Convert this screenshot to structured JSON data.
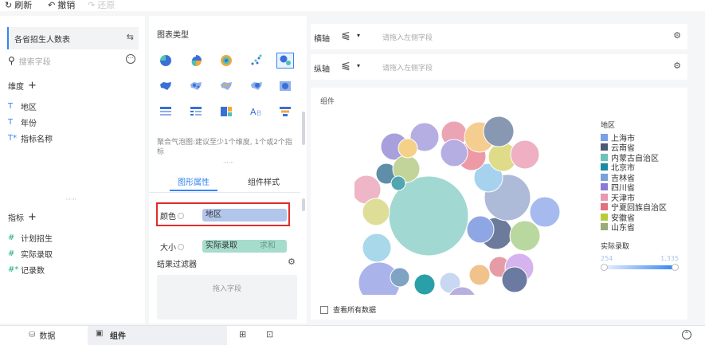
{
  "toolbar": {
    "refresh": "刷新",
    "undo": "撤销",
    "redo": "还原"
  },
  "left": {
    "dataset_name": "各省招生人数表",
    "search_placeholder": "搜索字段",
    "dimension_header": "维度",
    "dimensions": [
      {
        "type": "T",
        "label": "地区"
      },
      {
        "type": "T",
        "label": "年份"
      },
      {
        "type": "T*",
        "label": "指标名称"
      }
    ],
    "measure_header": "指标",
    "measures": [
      {
        "type": "#",
        "label": "计划招生"
      },
      {
        "type": "#",
        "label": "实际录取"
      },
      {
        "type": "#*",
        "label": "记录数"
      }
    ]
  },
  "mid": {
    "chart_type_title": "图表类型",
    "chart_hint": "聚合气泡图:建议至少1个维度, 1个或2个指标",
    "tab_shape": "图形属性",
    "tab_style": "组件样式",
    "color_label": "颜色",
    "color_value": "地区",
    "size_label": "大小",
    "size_value": "实际录取",
    "size_agg": "求和",
    "filter_title": "结果过滤器",
    "filter_drop": "拖入字段"
  },
  "right": {
    "x_axis_label": "横轴",
    "x_axis_placeholder": "请拖入左侧字段",
    "y_axis_label": "纵轴",
    "y_axis_placeholder": "请拖入左侧字段",
    "component_title": "组件",
    "legend_title": "地区",
    "legend": [
      {
        "name": "上海市",
        "color": "#7b9fe8"
      },
      {
        "name": "云南省",
        "color": "#4e5a74"
      },
      {
        "name": "内蒙古自治区",
        "color": "#6cc2b8"
      },
      {
        "name": "北京市",
        "color": "#1b8aa3"
      },
      {
        "name": "吉林省",
        "color": "#7aa0d8"
      },
      {
        "name": "四川省",
        "color": "#8a7ad8"
      },
      {
        "name": "天津市",
        "color": "#e898b0"
      },
      {
        "name": "宁夏回族自治区",
        "color": "#e2707e"
      },
      {
        "name": "安徽省",
        "color": "#b6cc3a"
      },
      {
        "name": "山东省",
        "color": "#9aaa78"
      }
    ],
    "size_legend_title": "实际录取",
    "size_min": "254",
    "size_max": "1,335",
    "show_all_label": "查看所有数据"
  },
  "bottom": {
    "tab_data": "数据",
    "tab_component": "组件"
  },
  "colors": {
    "accent": "#3685f2",
    "highlight_border": "#e22b2b",
    "pill_blue": "#b2c6ec",
    "pill_green": "#a6dccb"
  }
}
